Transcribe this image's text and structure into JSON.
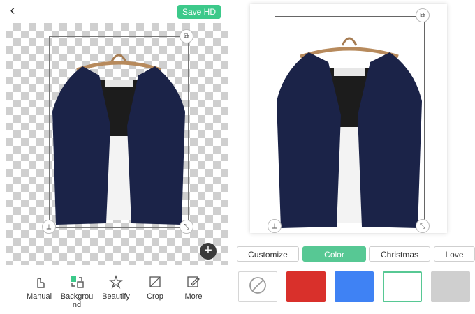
{
  "header": {
    "back_icon": "back-chevron-icon",
    "save_label": "Save HD"
  },
  "toolbar": [
    {
      "name": "manual",
      "label": "Manual",
      "icon": "hand-pointer-icon"
    },
    {
      "name": "background",
      "label": "Backgrou\nnd",
      "icon": "background-swap-icon"
    },
    {
      "name": "beautify",
      "label": "Beautify",
      "icon": "star-sparkle-icon"
    },
    {
      "name": "crop",
      "label": "Crop",
      "icon": "crop-icon"
    },
    {
      "name": "more",
      "label": "More",
      "icon": "edit-pencil-icon"
    }
  ],
  "tabs": [
    {
      "label": "Customize",
      "active": false
    },
    {
      "label": "Color",
      "active": true
    },
    {
      "label": "Christmas",
      "active": false
    },
    {
      "label": "Love",
      "active": false
    }
  ],
  "swatches": [
    {
      "name": "none",
      "color": "#ffffff"
    },
    {
      "name": "red",
      "color": "#d9302b"
    },
    {
      "name": "blue",
      "color": "#3f82f4"
    },
    {
      "name": "white",
      "color": "#ffffff",
      "selected": true
    },
    {
      "name": "gray",
      "color": "#cfcfcf"
    }
  ],
  "colors": {
    "accent": "#57c894",
    "save_button": "#3cc98a"
  }
}
